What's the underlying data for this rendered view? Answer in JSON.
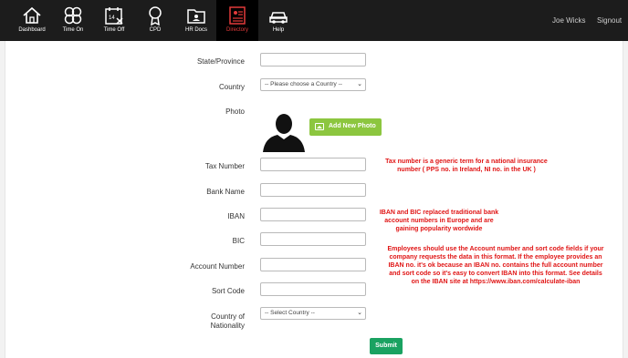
{
  "nav": {
    "items": [
      {
        "label": "Dashboard",
        "icon": "home-icon"
      },
      {
        "label": "Time On",
        "icon": "time-on-icon"
      },
      {
        "label": "Time Off",
        "icon": "calendar-icon"
      },
      {
        "label": "CPD",
        "icon": "award-icon"
      },
      {
        "label": "HR Docs",
        "icon": "folder-icon"
      },
      {
        "label": "Directory",
        "icon": "directory-icon",
        "active": true
      },
      {
        "label": "Help",
        "icon": "car-icon"
      }
    ],
    "user_name": "Joe Wicks",
    "signout": "Signout",
    "active_color": "#e23a3a"
  },
  "form": {
    "state_label": "State/Province",
    "country_label": "Country",
    "country_value": "-- Please choose a Country --",
    "photo_label": "Photo",
    "add_photo": "Add New Photo",
    "tax_label": "Tax Number",
    "bank_label": "Bank Name",
    "iban_label": "IBAN",
    "bic_label": "BIC",
    "account_label": "Account Number",
    "sort_label": "Sort Code",
    "nationality_label_1": "Country of",
    "nationality_label_2": "Nationality",
    "nationality_value": "-- Select Country --",
    "submit": "Submit"
  },
  "notes": {
    "tax_1": "Tax number is a generic term for a national insurance",
    "tax_2": "number ( PPS no. in Ireland, NI no. in the UK )",
    "iban_1": "IBAN and BIC replaced traditional bank",
    "iban_2": "account numbers in Europe and are",
    "iban_3": "gaining popularity wordwide",
    "acct_1": "Employees should use the Account number and sort code fields if your",
    "acct_2": "company requests the data in this format. If the employee provides an",
    "acct_3": "IBAN no. it's ok because an IBAN no. contains the full account number",
    "acct_4": "and sort code so it's easy to convert IBAN into this format. See details",
    "acct_5": "on the IBAN site at https://www.iban.com/calculate-iban"
  }
}
